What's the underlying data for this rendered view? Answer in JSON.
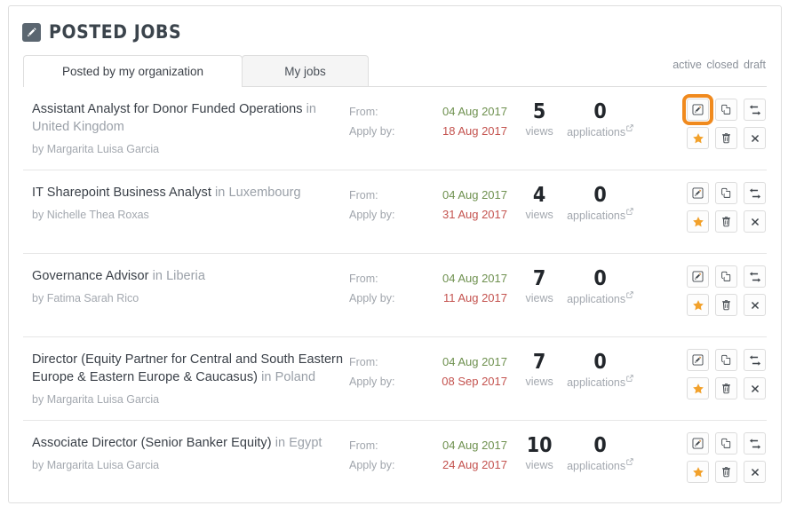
{
  "panel": {
    "title": "POSTED JOBS",
    "title_icon": "pencil-square-icon"
  },
  "tabs": [
    {
      "label": "Posted by my organization",
      "active": true
    },
    {
      "label": "My jobs",
      "active": false
    }
  ],
  "filters": [
    {
      "label": "active"
    },
    {
      "label": "closed"
    },
    {
      "label": "draft"
    }
  ],
  "labels": {
    "from": "From:",
    "apply_by": "Apply by:",
    "views": "views",
    "applications": "applications",
    "in": "in",
    "by": "by"
  },
  "colors": {
    "accent_orange": "#f08a1e",
    "star_orange": "#f2a12b",
    "date_from_green": "#6f9150",
    "date_apply_red": "#c4534f",
    "title_dark": "#3a4048",
    "muted_gray": "#a3a8af",
    "panel_border": "#dedede"
  },
  "actions": [
    {
      "name": "edit-button",
      "icon": "pencil-square-icon"
    },
    {
      "name": "duplicate-button",
      "icon": "copy-icon"
    },
    {
      "name": "repost-button",
      "icon": "exchange-arrows-icon"
    },
    {
      "name": "feature-button",
      "icon": "star-icon"
    },
    {
      "name": "delete-button",
      "icon": "trash-icon"
    },
    {
      "name": "close-button",
      "icon": "times-icon"
    }
  ],
  "jobs": [
    {
      "title": "Assistant Analyst for Donor Funded Operations",
      "location": "United Kingdom",
      "author": "Margarita Luisa Garcia",
      "from_date": "04 Aug 2017",
      "apply_by_date": "18 Aug 2017",
      "views": "5",
      "applications": "0",
      "edit_focused": true
    },
    {
      "title": "IT Sharepoint Business Analyst",
      "location": "Luxembourg",
      "author": "Nichelle Thea Roxas",
      "from_date": "04 Aug 2017",
      "apply_by_date": "31 Aug 2017",
      "views": "4",
      "applications": "0",
      "edit_focused": false
    },
    {
      "title": "Governance Advisor",
      "location": "Liberia",
      "author": "Fatima Sarah Rico",
      "from_date": "04 Aug 2017",
      "apply_by_date": "11 Aug 2017",
      "views": "7",
      "applications": "0",
      "edit_focused": false
    },
    {
      "title": "Director (Equity Partner for Central and South Eastern Europe & Eastern Europe & Caucasus)",
      "location": "Poland",
      "author": "Margarita Luisa Garcia",
      "from_date": "04 Aug 2017",
      "apply_by_date": "08 Sep 2017",
      "views": "7",
      "applications": "0",
      "edit_focused": false
    },
    {
      "title": "Associate Director (Senior Banker Equity)",
      "location": "Egypt",
      "author": "Margarita Luisa Garcia",
      "from_date": "04 Aug 2017",
      "apply_by_date": "24 Aug 2017",
      "views": "10",
      "applications": "0",
      "edit_focused": false
    }
  ]
}
